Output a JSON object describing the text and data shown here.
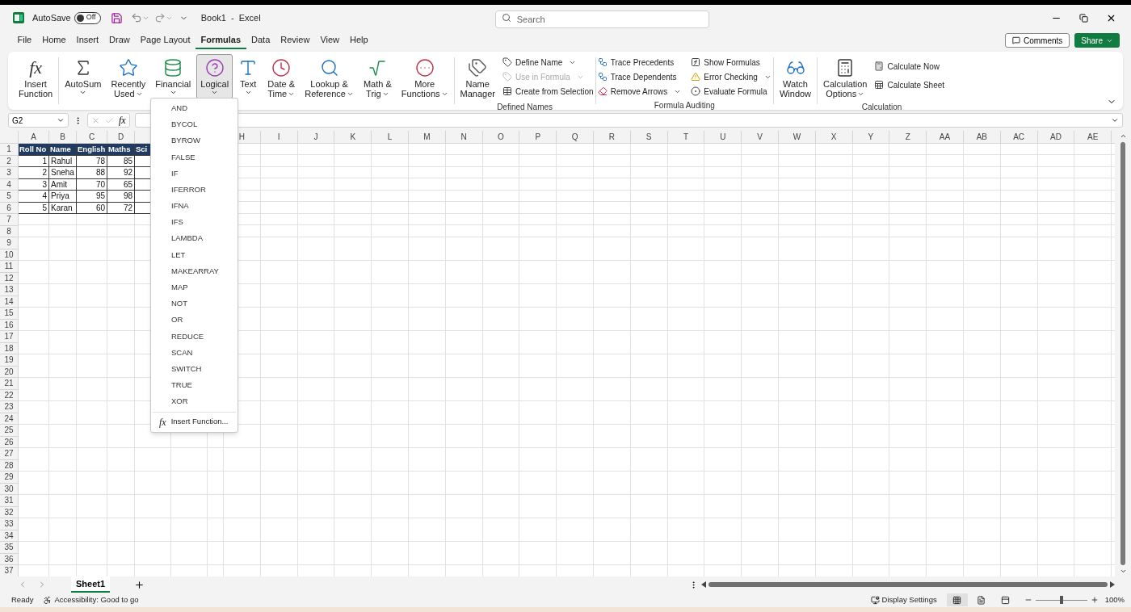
{
  "title_bar": {
    "autosave_label": "AutoSave",
    "autosave_toggle": {
      "label": "Off",
      "on": false
    },
    "title": "Book1  -  Excel",
    "search": {
      "placeholder": "Search"
    }
  },
  "menu_tabs": [
    {
      "label": "File",
      "selected": false
    },
    {
      "label": "Home",
      "selected": false
    },
    {
      "label": "Insert",
      "selected": false
    },
    {
      "label": "Draw",
      "selected": false
    },
    {
      "label": "Page Layout",
      "selected": false
    },
    {
      "label": "Formulas",
      "selected": true
    },
    {
      "label": "Data",
      "selected": false
    },
    {
      "label": "Review",
      "selected": false
    },
    {
      "label": "View",
      "selected": false
    },
    {
      "label": "Help",
      "selected": false
    }
  ],
  "header_buttons": {
    "comments": "Comments",
    "share": "Share"
  },
  "ribbon": {
    "function_library": [
      {
        "lines": [
          "Insert",
          "Function"
        ],
        "icon_text": "fx",
        "dropdown": false,
        "selected": false
      },
      {
        "lines": [
          "AutoSum"
        ],
        "dropdown": true,
        "selected": false
      },
      {
        "lines": [
          "Recently",
          "Used"
        ],
        "dropdown": true,
        "selected": false
      },
      {
        "lines": [
          "Financial"
        ],
        "dropdown": true,
        "selected": false
      },
      {
        "lines": [
          "Logical"
        ],
        "dropdown": true,
        "selected": true
      },
      {
        "lines": [
          "Text"
        ],
        "dropdown": true,
        "selected": false
      },
      {
        "lines": [
          "Date &",
          "Time"
        ],
        "dropdown": true,
        "selected": false
      },
      {
        "lines": [
          "Lookup &",
          "Reference"
        ],
        "dropdown": true,
        "selected": false
      },
      {
        "lines": [
          "Math &",
          "Trig"
        ],
        "dropdown": true,
        "selected": false
      },
      {
        "lines": [
          "More",
          "Functions"
        ],
        "dropdown": true,
        "selected": false
      }
    ],
    "defined_names": {
      "big": {
        "lines": [
          "Name",
          "Manager"
        ]
      },
      "small": [
        {
          "label": "Define Name",
          "dropdown": true,
          "disabled": false
        },
        {
          "label": "Use in Formula",
          "dropdown": true,
          "disabled": true
        },
        {
          "label": "Create from Selection",
          "dropdown": false,
          "disabled": false
        }
      ],
      "label": "Defined Names"
    },
    "formula_auditing": {
      "column_1": [
        {
          "label": "Trace Precedents",
          "dropdown": false
        },
        {
          "label": "Trace Dependents",
          "dropdown": false
        },
        {
          "label": "Remove Arrows",
          "dropdown": true
        }
      ],
      "column_2": [
        {
          "label": "Show Formulas",
          "dropdown": false
        },
        {
          "label": "Error Checking",
          "dropdown": true
        },
        {
          "label": "Evaluate Formula",
          "dropdown": false
        }
      ],
      "watch": {
        "lines": [
          "Watch",
          "Window"
        ]
      },
      "label": "Formula Auditing"
    },
    "calculation": {
      "big": {
        "lines": [
          "Calculation",
          "Options"
        ]
      },
      "small": [
        "Calculate Now",
        "Calculate Sheet"
      ],
      "label": "Calculation"
    }
  },
  "formula_bar": {
    "name_box": "G2",
    "fx": "fx"
  },
  "sheet": {
    "column_headers_left": [
      "A",
      "B",
      "C",
      "D"
    ],
    "column_headers_right": [
      "H",
      "I",
      "J",
      "K",
      "L",
      "M",
      "N",
      "O",
      "P",
      "Q",
      "R",
      "S",
      "T",
      "U",
      "V",
      "W",
      "X",
      "Y",
      "Z",
      "AA",
      "AB",
      "AC",
      "AD",
      "AE"
    ],
    "row_numbers": [
      "1",
      "2",
      "3",
      "4",
      "5",
      "6",
      "7",
      "8",
      "9",
      "10",
      "11",
      "12",
      "13",
      "14",
      "15",
      "16",
      "17",
      "18",
      "19",
      "20",
      "21",
      "22",
      "23",
      "24",
      "25",
      "26",
      "27",
      "28",
      "29",
      "30",
      "31",
      "32",
      "33",
      "34",
      "35",
      "36",
      "37"
    ],
    "table": {
      "header": [
        "Roll No",
        "Name",
        "English",
        "Maths",
        "Sci"
      ],
      "rows": [
        [
          "1",
          "Rahul",
          "78",
          "85"
        ],
        [
          "2",
          "Sneha",
          "88",
          "92"
        ],
        [
          "3",
          "Amit",
          "70",
          "65"
        ],
        [
          "4",
          "Priya",
          "95",
          "98"
        ],
        [
          "5",
          "Karan",
          "60",
          "72"
        ]
      ]
    }
  },
  "logical_menu": {
    "items": [
      "AND",
      "BYCOL",
      "BYROW",
      "FALSE",
      "IF",
      "IFERROR",
      "IFNA",
      "IFS",
      "LAMBDA",
      "LET",
      "MAKEARRAY",
      "MAP",
      "NOT",
      "OR",
      "REDUCE",
      "SCAN",
      "SWITCH",
      "TRUE",
      "XOR"
    ],
    "insert_function": {
      "icon_text": "fx",
      "label": "Insert Function..."
    }
  },
  "sheet_tabs": [
    {
      "label": "Sheet1",
      "selected": true
    }
  ],
  "status_bar": {
    "ready": "Ready",
    "accessibility": "Accessibility: Good to go",
    "display_settings": "Display Settings",
    "views": [
      {
        "selected": true
      },
      {
        "selected": false
      },
      {
        "selected": false
      }
    ],
    "zoom": {
      "level": 0.5,
      "reading": "100%"
    }
  }
}
